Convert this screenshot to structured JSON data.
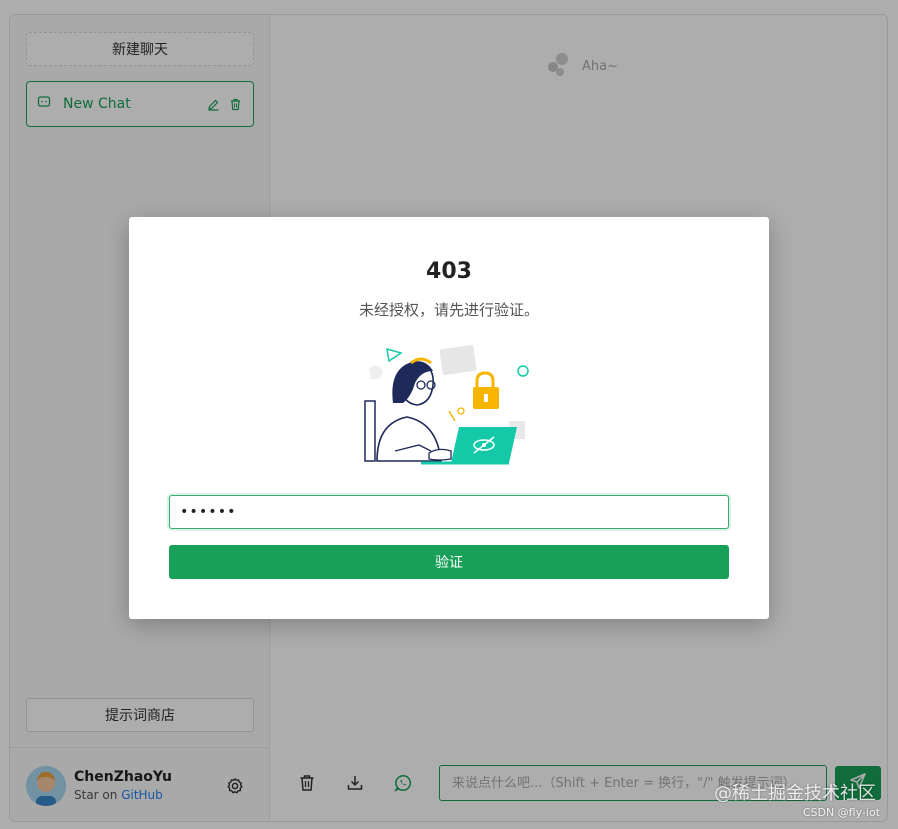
{
  "sidebar": {
    "new_chat_label": "新建聊天",
    "chats": [
      {
        "label": "New Chat"
      }
    ],
    "prompt_store_label": "提示词商店"
  },
  "user": {
    "name": "ChenZhaoYu",
    "star_prefix": "Star on ",
    "star_link": "GitHub"
  },
  "main": {
    "greeting": "Aha~",
    "input_placeholder": "来说点什么吧...（Shift + Enter = 换行，\"/\" 触发提示词）"
  },
  "modal": {
    "title": "403",
    "description": "未经授权，请先进行验证。",
    "password_value": "••••••",
    "verify_label": "验证"
  },
  "watermark": {
    "line1": "@稀土掘金技术社区",
    "line2": "CSDN @fly-iot"
  },
  "colors": {
    "accent": "#18a058",
    "link": "#2080f0"
  }
}
